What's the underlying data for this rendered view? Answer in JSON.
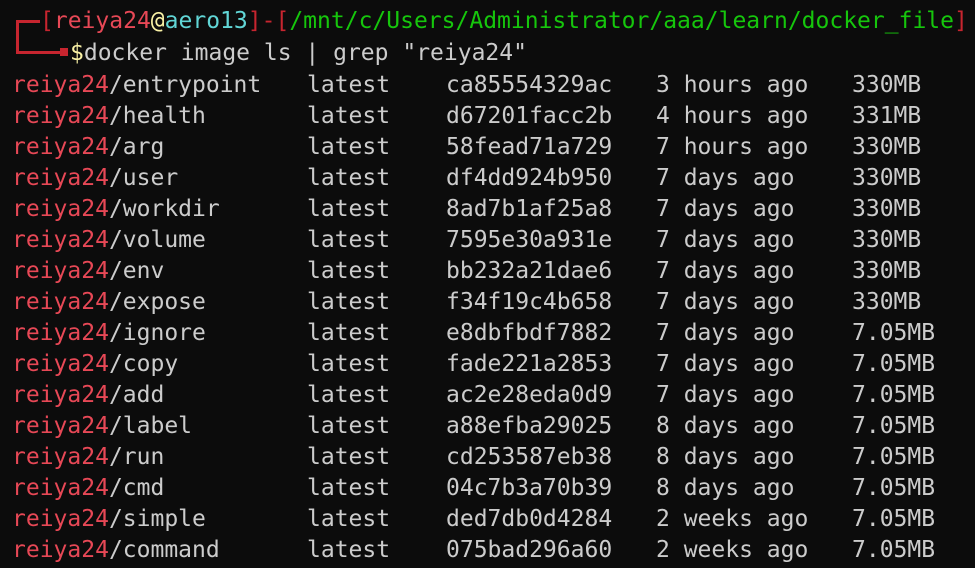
{
  "prompt": {
    "open_bracket": "[",
    "user": "reiya24",
    "at": "@",
    "host": "aero13",
    "close_bracket": "]",
    "dash": "-",
    "path_open": "[",
    "path": "/mnt/c/Users/Administrator/aaa/learn/docker_file",
    "path_close": "]",
    "dollar": "$",
    "command": "docker image ls | grep \"reiya24\""
  },
  "rows": [
    {
      "user": "reiya24",
      "name": "/entrypoint",
      "tag": "latest",
      "id": "ca85554329ac",
      "created": "3 hours ago",
      "size": "330MB"
    },
    {
      "user": "reiya24",
      "name": "/health",
      "tag": "latest",
      "id": "d67201facc2b",
      "created": "4 hours ago",
      "size": "331MB"
    },
    {
      "user": "reiya24",
      "name": "/arg",
      "tag": "latest",
      "id": "58fead71a729",
      "created": "7 hours ago",
      "size": "330MB"
    },
    {
      "user": "reiya24",
      "name": "/user",
      "tag": "latest",
      "id": "df4dd924b950",
      "created": "7 days ago",
      "size": "330MB"
    },
    {
      "user": "reiya24",
      "name": "/workdir",
      "tag": "latest",
      "id": "8ad7b1af25a8",
      "created": "7 days ago",
      "size": "330MB"
    },
    {
      "user": "reiya24",
      "name": "/volume",
      "tag": "latest",
      "id": "7595e30a931e",
      "created": "7 days ago",
      "size": "330MB"
    },
    {
      "user": "reiya24",
      "name": "/env",
      "tag": "latest",
      "id": "bb232a21dae6",
      "created": "7 days ago",
      "size": "330MB"
    },
    {
      "user": "reiya24",
      "name": "/expose",
      "tag": "latest",
      "id": "f34f19c4b658",
      "created": "7 days ago",
      "size": "330MB"
    },
    {
      "user": "reiya24",
      "name": "/ignore",
      "tag": "latest",
      "id": "e8dbfbdf7882",
      "created": "7 days ago",
      "size": "7.05MB"
    },
    {
      "user": "reiya24",
      "name": "/copy",
      "tag": "latest",
      "id": "fade221a2853",
      "created": "7 days ago",
      "size": "7.05MB"
    },
    {
      "user": "reiya24",
      "name": "/add",
      "tag": "latest",
      "id": "ac2e28eda0d9",
      "created": "7 days ago",
      "size": "7.05MB"
    },
    {
      "user": "reiya24",
      "name": "/label",
      "tag": "latest",
      "id": "a88efba29025",
      "created": "8 days ago",
      "size": "7.05MB"
    },
    {
      "user": "reiya24",
      "name": "/run",
      "tag": "latest",
      "id": "cd253587eb38",
      "created": "8 days ago",
      "size": "7.05MB"
    },
    {
      "user": "reiya24",
      "name": "/cmd",
      "tag": "latest",
      "id": "04c7b3a70b39",
      "created": "8 days ago",
      "size": "7.05MB"
    },
    {
      "user": "reiya24",
      "name": "/simple",
      "tag": "latest",
      "id": "ded7db0d4284",
      "created": "2 weeks ago",
      "size": "7.05MB"
    },
    {
      "user": "reiya24",
      "name": "/command",
      "tag": "latest",
      "id": "075bad296a60",
      "created": "2 weeks ago",
      "size": "7.05MB"
    }
  ],
  "colors": {
    "background": "#0c0c0c",
    "foreground": "#cccccc",
    "user_red": "#e74856",
    "bracket_red": "#c7252f",
    "host_cyan": "#61d6d6",
    "path_green": "#16c60c",
    "at_yellow": "#f9f1a5"
  }
}
